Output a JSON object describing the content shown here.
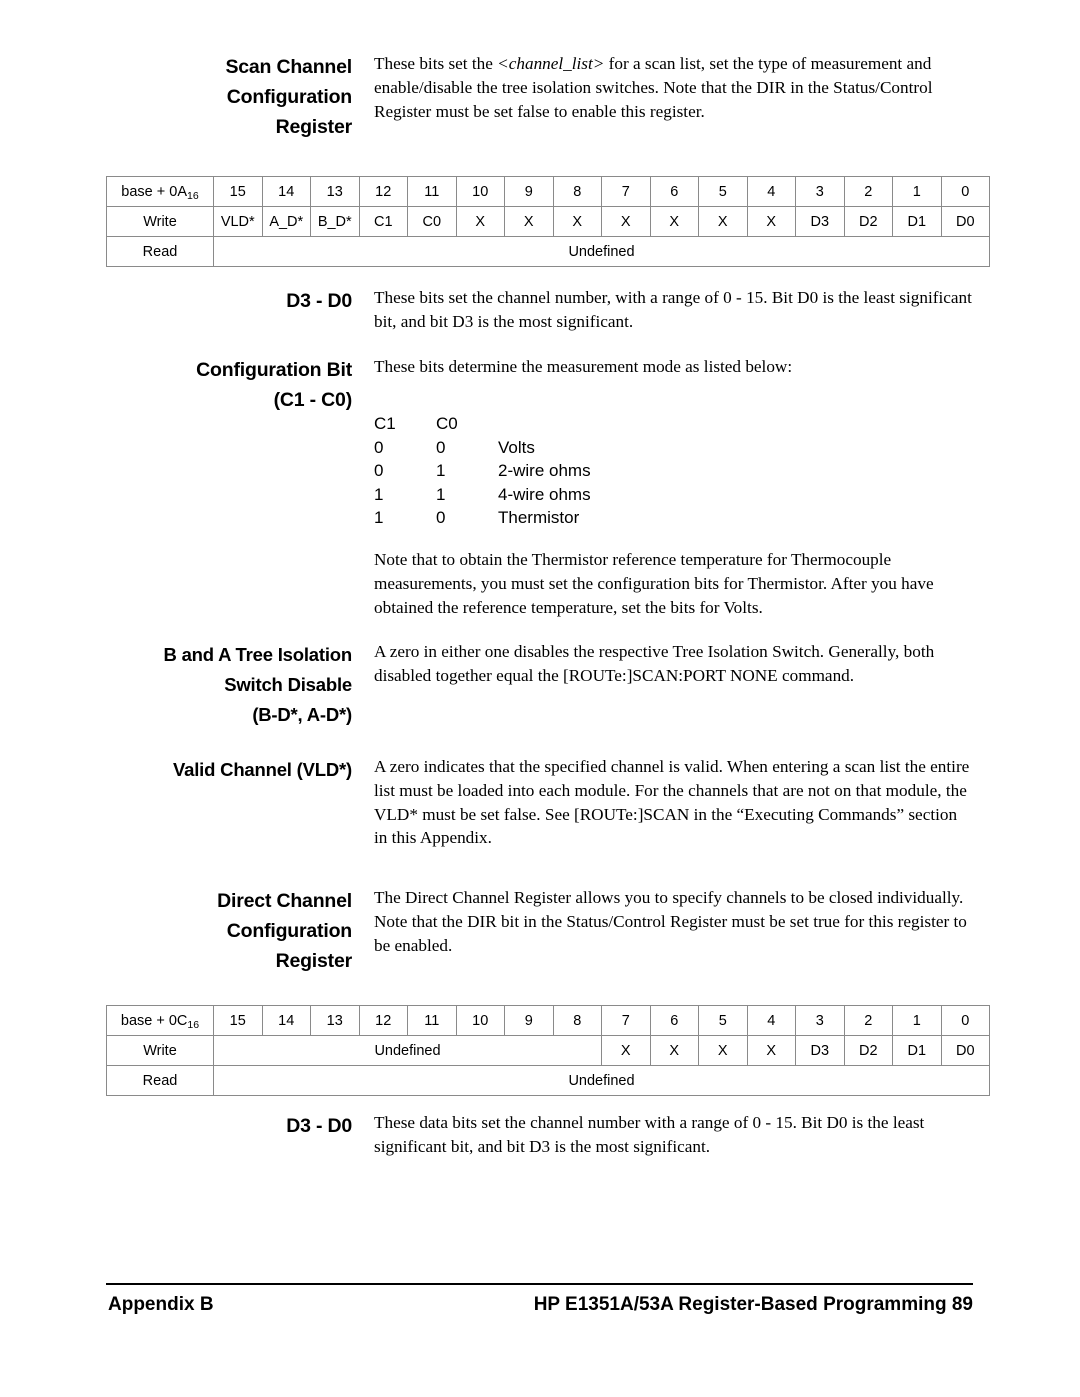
{
  "page": {
    "number": "89",
    "footer_left": "Appendix B",
    "footer_right": "HP E1351A/53A Register-Based Programming  89"
  },
  "sections": {
    "scan_channel": {
      "heading_line1": "Scan Channel",
      "heading_line2": "Configuration",
      "heading_line3": "Register",
      "body_part1": "These bits set the ",
      "body_italic": "<channel_list>",
      "body_part2": " for a scan list, set the type of measurement and enable/disable the tree isolation switches.  Note that the DIR in the Status/Control Register must be set false to enable this register."
    },
    "d3_d0_scan": {
      "heading": "D3 - D0",
      "body": "These bits set the channel number, with a range of 0 - 15.  Bit D0 is the least significant bit, and bit D3 is the most significant."
    },
    "config_bit": {
      "heading_line1": "Configuration Bit",
      "heading_line2": "(C1 - C0)",
      "body": "These bits determine the measurement mode as listed below:"
    },
    "thermistor_note": {
      "body": "Note that to obtain the Thermistor reference temperature for Thermocouple measurements, you must set the configuration bits for Thermistor.  After you have obtained the reference temperature, set the bits for Volts."
    },
    "tree_isolation": {
      "heading_line1": "B and A Tree Isolation",
      "heading_line2": "Switch Disable",
      "heading_line3": "(B-D*, A-D*)",
      "body": "A zero in either one disables the respective Tree Isolation Switch.  Generally, both disabled together equal the [ROUTe:]SCAN:PORT NONE command."
    },
    "valid_channel": {
      "heading": "Valid Channel (VLD*)",
      "body": "A zero indicates that the specified channel is valid.  When entering a scan list the entire list must be loaded into each module.  For the channels that are not on that module, the VLD* must be set false.  See [ROUTe:]SCAN in the “Executing Commands” section in this Appendix."
    },
    "direct_channel": {
      "heading_line1": "Direct Channel",
      "heading_line2": "Configuration",
      "heading_line3": "Register",
      "body": "The Direct Channel Register allows you to specify channels to be closed individually.  Note that the DIR bit in the Status/Control Register must be set true for this register to be enabled."
    },
    "d3_d0_direct": {
      "heading": "D3 - D0",
      "body": "These data bits set the channel number with a range of 0 - 15.  Bit D0 is the least significant bit, and bit D3 is the most significant."
    }
  },
  "truth_table": {
    "header": {
      "c1": "C1",
      "c0": "C0",
      "mode": ""
    },
    "rows": [
      {
        "c1": "0",
        "c0": "0",
        "mode": "Volts"
      },
      {
        "c1": "0",
        "c0": "1",
        "mode": "2-wire ohms"
      },
      {
        "c1": "1",
        "c0": "1",
        "mode": "4-wire ohms"
      },
      {
        "c1": "1",
        "c0": "0",
        "mode": "Thermistor"
      }
    ]
  },
  "register_table_scan": {
    "address_prefix": "base + 0A",
    "address_subscript": "16",
    "bit_numbers": [
      "15",
      "14",
      "13",
      "12",
      "11",
      "10",
      "9",
      "8",
      "7",
      "6",
      "5",
      "4",
      "3",
      "2",
      "1",
      "0"
    ],
    "write_label": "Write",
    "write_cells": [
      "VLD*",
      "A_D*",
      "B_D*",
      "C1",
      "C0",
      "X",
      "X",
      "X",
      "X",
      "X",
      "X",
      "X",
      "D3",
      "D2",
      "D1",
      "D0"
    ],
    "read_label": "Read",
    "read_value": "Undefined"
  },
  "register_table_direct": {
    "address_prefix": "base + 0C",
    "address_subscript": "16",
    "bit_numbers": [
      "15",
      "14",
      "13",
      "12",
      "11",
      "10",
      "9",
      "8",
      "7",
      "6",
      "5",
      "4",
      "3",
      "2",
      "1",
      "0"
    ],
    "write_label": "Write",
    "write_undefined": "Undefined",
    "write_undefined_span": 8,
    "write_cells_tail": [
      "X",
      "X",
      "X",
      "X",
      "D3",
      "D2",
      "D1",
      "D0"
    ],
    "read_label": "Read",
    "read_value": "Undefined"
  },
  "colors": {
    "text": "#000000",
    "background": "#ffffff",
    "table_border": "#8a8a8a",
    "footer_rule": "#000000"
  }
}
